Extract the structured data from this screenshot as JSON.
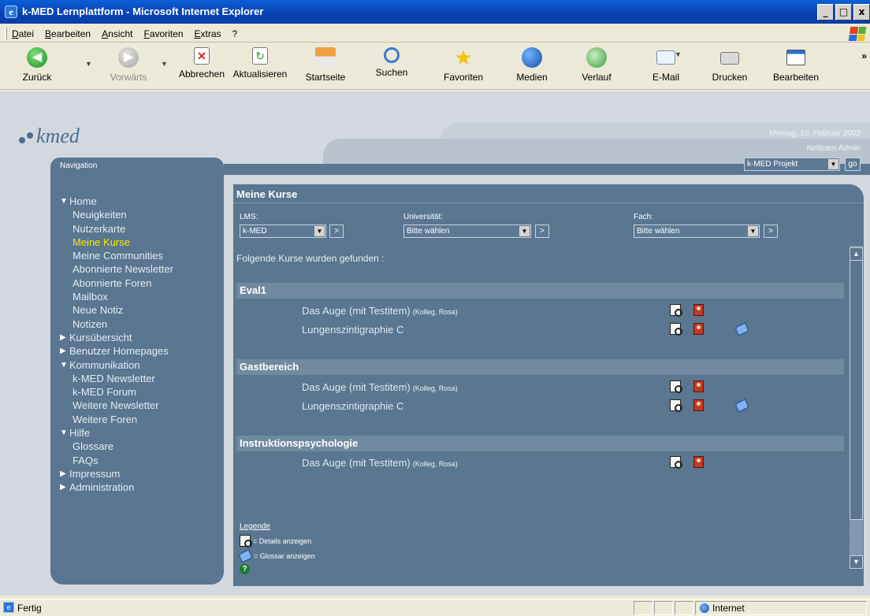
{
  "window": {
    "title": "k-MED Lernplattform - Microsoft Internet Explorer",
    "controls": [
      "_",
      "□",
      "x"
    ]
  },
  "menu": [
    "Datei",
    "Bearbeiten",
    "Ansicht",
    "Favoriten",
    "Extras",
    "?"
  ],
  "toolbar": {
    "back": "Zurück",
    "forward": "Vorwärts",
    "stop": "Abbrechen",
    "refresh": "Aktualisieren",
    "home": "Startseite",
    "search": "Suchen",
    "favorites": "Favoriten",
    "media": "Medien",
    "history": "Verlauf",
    "mail": "E-Mail",
    "print": "Drucken",
    "edit": "Bearbeiten",
    "more": "»"
  },
  "page": {
    "logo": "kmed",
    "date": "Montag, 10. Februar 2003",
    "user": "Netlearn Admin",
    "navigation_title": "Navigation",
    "project_select": "k-MED Projekt",
    "go_label": "go"
  },
  "nav": {
    "home": "Home",
    "home_items": [
      "Neuigkeiten",
      "Nutzerkarte",
      "Meine Kurse",
      "Meine Communities",
      "Abonnierte Newsletter",
      "Abonnierte Foren",
      "Mailbox",
      "Neue Notiz",
      "Notizen"
    ],
    "kursuebersicht": "Kursübersicht",
    "benutzer_homepages": "Benutzer Homepages",
    "kommunikation": "Kommunikation",
    "kommunikation_items": [
      "k-MED Newsletter",
      "k-MED Forum",
      "Weitere Newsletter",
      "Weitere Foren"
    ],
    "hilfe": "Hilfe",
    "hilfe_items": [
      "Glossare",
      "FAQs"
    ],
    "impressum": "Impressum",
    "administration": "Administration"
  },
  "main": {
    "title": "Meine Kurse",
    "filters": {
      "lms_label": "LMS:",
      "lms_value": "k-MED",
      "uni_label": "Universität:",
      "uni_value": "Bitte wählen",
      "fach_label": "Fach:",
      "fach_value": "Bitte wählen",
      "go_symbol": ">"
    },
    "found_text": "Folgende Kurse wurden gefunden :",
    "groups": [
      {
        "name": "Eval1",
        "courses": [
          {
            "title": "Das Auge (mit Testitem)",
            "tutors": "(Kolleg, Rosa)"
          },
          {
            "title": "Lungenszintigraphie C",
            "tutors": ""
          }
        ]
      },
      {
        "name": "Gastbereich",
        "courses": [
          {
            "title": "Das Auge (mit Testitem)",
            "tutors": "(Kolleg, Rosa)"
          },
          {
            "title": "Lungenszintigraphie C",
            "tutors": ""
          }
        ]
      },
      {
        "name": "Instruktionspsychologie",
        "courses": [
          {
            "title": "Das Auge (mit Testitem)",
            "tutors": "(Kolleg, Rosa)"
          }
        ]
      }
    ],
    "legend": {
      "title": "Legende",
      "details": "= Details anzeigen",
      "glossar": "= Glossar anzeigen",
      "help_symbol": "?"
    },
    "scroll_up": "▲",
    "scroll_down": "▼"
  },
  "status": {
    "text": "Fertig",
    "zone": "Internet"
  },
  "colors": {
    "panel": "#5a7690",
    "group_header": "#728aa0",
    "active_nav": "#ffe600",
    "background": "#d2d8de"
  }
}
